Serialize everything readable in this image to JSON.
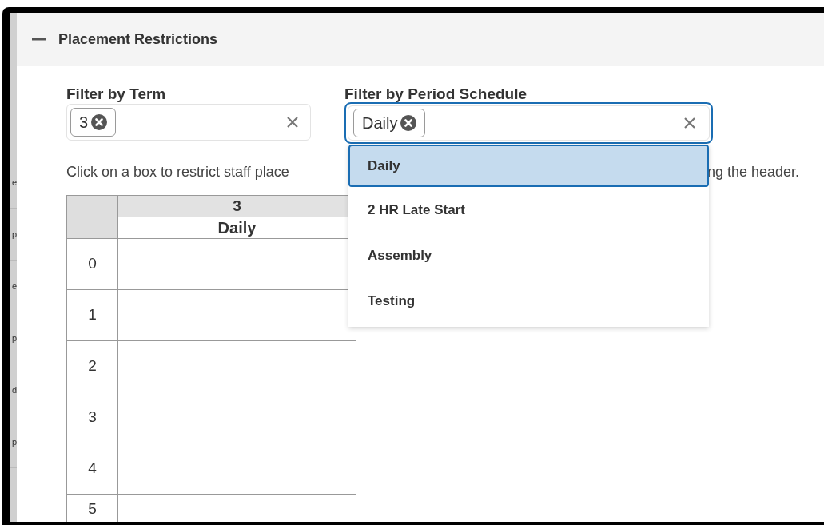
{
  "section": {
    "title": "Placement Restrictions",
    "expanded": true
  },
  "background_fragments": [
    "e",
    "p",
    "e",
    "p",
    "d",
    "p"
  ],
  "filters": [
    {
      "label": "Filter by Term",
      "chips": [
        "3"
      ],
      "focused": false
    },
    {
      "label": "Filter by Period Schedule",
      "chips": [
        "Daily"
      ],
      "focused": true,
      "options": [
        {
          "label": "Daily",
          "selected": true
        },
        {
          "label": "2 HR Late Start",
          "selected": false
        },
        {
          "label": "Assembly",
          "selected": false
        },
        {
          "label": "Testing",
          "selected": false
        }
      ]
    }
  ],
  "instruction": [
    "Click on a box to restrict staff place",
    "ng the header."
  ],
  "table": {
    "column_header": [
      "3",
      "Daily"
    ],
    "rows": [
      "0",
      "1",
      "2",
      "3",
      "4",
      "5"
    ]
  }
}
